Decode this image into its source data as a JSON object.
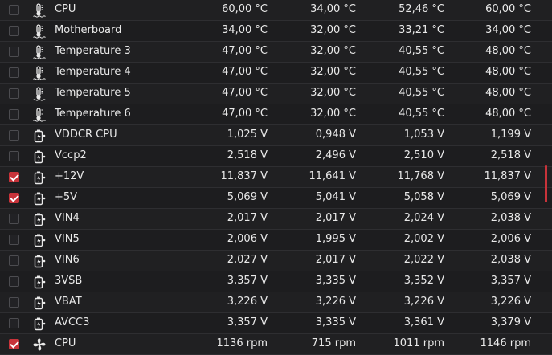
{
  "sensors": [
    {
      "icon": "thermometer",
      "name": "CPU",
      "checked": false,
      "current": "60,00 °C",
      "min": "34,00 °C",
      "avg": "52,46 °C",
      "max": "60,00 °C"
    },
    {
      "icon": "thermometer",
      "name": "Motherboard",
      "checked": false,
      "current": "34,00 °C",
      "min": "32,00 °C",
      "avg": "33,21 °C",
      "max": "34,00 °C"
    },
    {
      "icon": "thermometer",
      "name": "Temperature 3",
      "checked": false,
      "current": "47,00 °C",
      "min": "32,00 °C",
      "avg": "40,55 °C",
      "max": "48,00 °C"
    },
    {
      "icon": "thermometer",
      "name": "Temperature 4",
      "checked": false,
      "current": "47,00 °C",
      "min": "32,00 °C",
      "avg": "40,55 °C",
      "max": "48,00 °C"
    },
    {
      "icon": "thermometer",
      "name": "Temperature 5",
      "checked": false,
      "current": "47,00 °C",
      "min": "32,00 °C",
      "avg": "40,55 °C",
      "max": "48,00 °C"
    },
    {
      "icon": "thermometer",
      "name": "Temperature 6",
      "checked": false,
      "current": "47,00 °C",
      "min": "32,00 °C",
      "avg": "40,55 °C",
      "max": "48,00 °C"
    },
    {
      "icon": "battery",
      "name": "VDDCR CPU",
      "checked": false,
      "current": "1,025 V",
      "min": "0,948 V",
      "avg": "1,053 V",
      "max": "1,199 V"
    },
    {
      "icon": "battery",
      "name": "Vccp2",
      "checked": false,
      "current": "2,518 V",
      "min": "2,496 V",
      "avg": "2,510 V",
      "max": "2,518 V"
    },
    {
      "icon": "battery",
      "name": "+12V",
      "checked": true,
      "current": "11,837 V",
      "min": "11,641 V",
      "avg": "11,768 V",
      "max": "11,837 V"
    },
    {
      "icon": "battery",
      "name": "+5V",
      "checked": true,
      "current": "5,069 V",
      "min": "5,041 V",
      "avg": "5,058 V",
      "max": "5,069 V"
    },
    {
      "icon": "battery",
      "name": "VIN4",
      "checked": false,
      "current": "2,017 V",
      "min": "2,017 V",
      "avg": "2,024 V",
      "max": "2,038 V"
    },
    {
      "icon": "battery",
      "name": "VIN5",
      "checked": false,
      "current": "2,006 V",
      "min": "1,995 V",
      "avg": "2,002 V",
      "max": "2,006 V"
    },
    {
      "icon": "battery",
      "name": "VIN6",
      "checked": false,
      "current": "2,027 V",
      "min": "2,017 V",
      "avg": "2,022 V",
      "max": "2,038 V"
    },
    {
      "icon": "battery",
      "name": "3VSB",
      "checked": false,
      "current": "3,357 V",
      "min": "3,335 V",
      "avg": "3,352 V",
      "max": "3,357 V"
    },
    {
      "icon": "battery",
      "name": "VBAT",
      "checked": false,
      "current": "3,226 V",
      "min": "3,226 V",
      "avg": "3,226 V",
      "max": "3,226 V"
    },
    {
      "icon": "battery",
      "name": "AVCC3",
      "checked": false,
      "current": "3,357 V",
      "min": "3,335 V",
      "avg": "3,361 V",
      "max": "3,379 V"
    },
    {
      "icon": "fan",
      "name": "CPU",
      "checked": true,
      "current": "1136 rpm",
      "min": "715 rpm",
      "avg": "1011 rpm",
      "max": "1146 rpm"
    }
  ],
  "colors": {
    "accent": "#c8333a",
    "background": "#1c1c1e",
    "text": "#e9e9e9"
  }
}
